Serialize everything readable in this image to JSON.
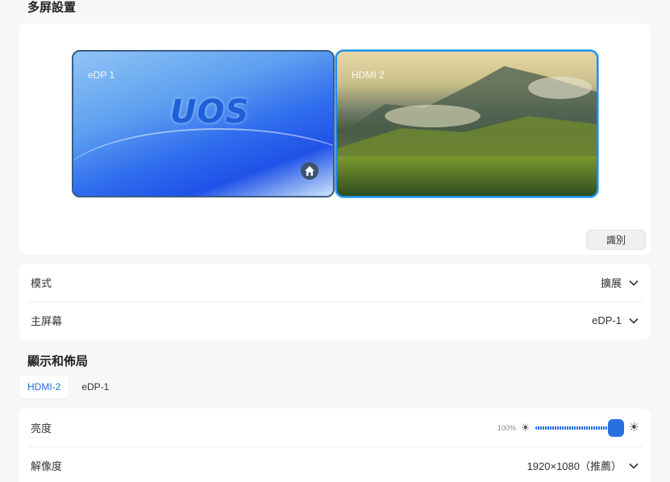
{
  "sections": {
    "multi_screen_title": "多屏設置",
    "display_layout_title": "顯示和佈局"
  },
  "monitors": {
    "edp": {
      "label": "eDP 1",
      "logo_text": "UOS"
    },
    "hdmi": {
      "label": "HDMI 2"
    },
    "identify_label": "識別"
  },
  "settings": {
    "mode": {
      "label": "模式",
      "value": "擴展"
    },
    "primary": {
      "label": "主屏幕",
      "value": "eDP-1"
    }
  },
  "tabs": [
    {
      "label": "HDMI-2",
      "active": true
    },
    {
      "label": "eDP-1",
      "active": false
    }
  ],
  "display": {
    "brightness": {
      "label": "亮度",
      "percent_text": "100%",
      "level": 1.0
    },
    "resolution": {
      "label": "解像度",
      "value": "1920×1080（推薦）"
    }
  },
  "colors": {
    "accent": "#2a6fe0",
    "selected_border": "#1e8fe8"
  }
}
